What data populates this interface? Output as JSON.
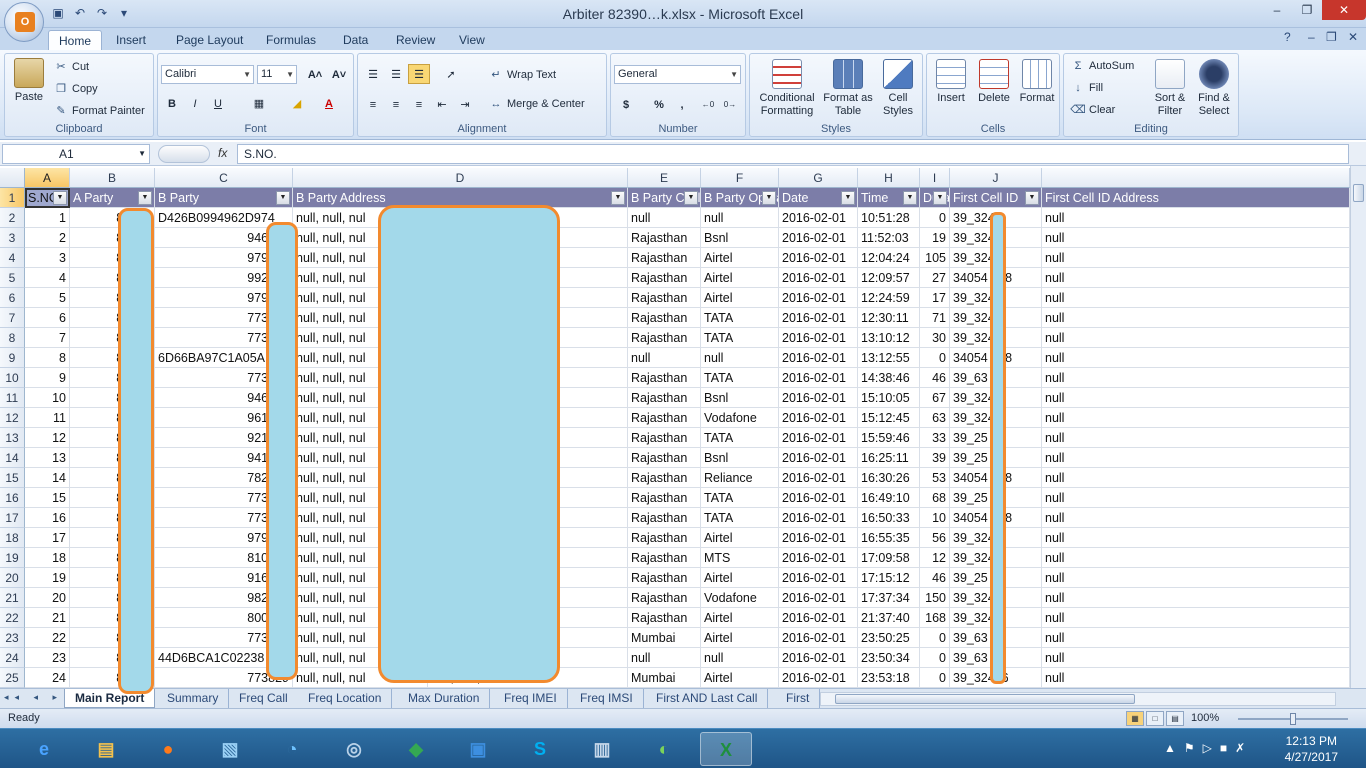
{
  "window": {
    "title": "Arbiter 82390…k.xlsx - Microsoft Excel",
    "min": "–",
    "restore": "❐",
    "close": "✕",
    "ribbon_min": "–",
    "ribbon_restore": "❐",
    "ribbon_close": "✕"
  },
  "office_button": "Ofc",
  "qat": {
    "save": "💾",
    "undo": "↶",
    "redo": "↷",
    "customize": "▾"
  },
  "tabs": [
    "Home",
    "Insert",
    "Page Layout",
    "Formulas",
    "Data",
    "Review",
    "View"
  ],
  "help": "?",
  "ribbon": {
    "clipboard": {
      "label": "Clipboard",
      "paste": "Paste",
      "cut": "Cut",
      "copy": "Copy",
      "format_painter": "Format Painter"
    },
    "font": {
      "label": "Font",
      "name": "Calibri",
      "size": "11",
      "bold": "B",
      "italic": "I",
      "underline": "U",
      "grow": "A˄",
      "shrink": "A˅"
    },
    "alignment": {
      "label": "Alignment",
      "wrap_text": "Wrap Text",
      "merge_center": "Merge & Center"
    },
    "number": {
      "label": "Number",
      "format": "General",
      "currency": "$",
      "percent": "%",
      "comma": ",",
      "inc_dec": ".0→.00",
      "dec_dec": ".00→.0"
    },
    "styles": {
      "label": "Styles",
      "conditional": "Conditional Formatting",
      "format_table": "Format as Table",
      "cell_styles": "Cell Styles"
    },
    "cells": {
      "label": "Cells",
      "insert": "Insert",
      "delete": "Delete",
      "format": "Format"
    },
    "editing": {
      "label": "Editing",
      "autosum": "AutoSum",
      "fill": "Fill",
      "clear": "Clear",
      "sort_filter": "Sort & Filter",
      "find_select": "Find & Select"
    }
  },
  "formula_bar": {
    "name_box": "A1",
    "fx": "fx",
    "content": "S.NO."
  },
  "columns": [
    "A",
    "B",
    "C",
    "D",
    "E",
    "F",
    "G",
    "H",
    "I",
    "J"
  ],
  "headers": [
    "S.NO.",
    "A Party",
    "B Party",
    "B Party Address",
    "B Party Circle",
    "B Party Operator",
    "Date",
    "Time",
    "Duration",
    "First Cell ID",
    "First Cell ID Address"
  ],
  "rows": [
    [
      "1",
      "82390",
      "D426B0994962D974",
      "null, null, nul",
      "null, null, null",
      "null",
      "null",
      "2016-02-01",
      "10:51:28",
      "0",
      "39_324",
      "null"
    ],
    [
      "2",
      "82390",
      "946107",
      "null, null, nul",
      "null, null, null",
      "Rajasthan",
      "Bsnl",
      "2016-02-01",
      "11:52:03",
      "19",
      "39_324",
      "null"
    ],
    [
      "3",
      "82390",
      "979973",
      "null, null, nul",
      "null, null, null",
      "Rajasthan",
      "Airtel",
      "2016-02-01",
      "12:04:24",
      "105",
      "39_324",
      "null"
    ],
    [
      "4",
      "82390",
      "992800",
      "null, null, nul",
      "null, null, null",
      "Rajasthan",
      "Airtel",
      "2016-02-01",
      "12:09:57",
      "27",
      "34054 738",
      "null"
    ],
    [
      "5",
      "82390",
      "979973",
      "null, null, nul",
      "null, null, null",
      "Rajasthan",
      "Airtel",
      "2016-02-01",
      "12:24:59",
      "17",
      "39_324",
      "null"
    ],
    [
      "6",
      "82390",
      "773792",
      "null, null, nul",
      "null, null, null",
      "Rajasthan",
      "TATA",
      "2016-02-01",
      "12:30:11",
      "71",
      "39_324",
      "null"
    ],
    [
      "7",
      "82390",
      "773792",
      "null, null, nul",
      "null, null, null",
      "Rajasthan",
      "TATA",
      "2016-02-01",
      "13:10:12",
      "30",
      "39_324",
      "null"
    ],
    [
      "8",
      "82390",
      "6D66BA97C1A05A",
      "null, null, nul",
      "null, null, null",
      "null",
      "null",
      "2016-02-01",
      "13:12:55",
      "0",
      "34054 738",
      "null"
    ],
    [
      "9",
      "82390",
      "773700",
      "null, null, nul",
      "null, null, null",
      "Rajasthan",
      "TATA",
      "2016-02-01",
      "14:38:46",
      "46",
      "39_63",
      "null"
    ],
    [
      "10",
      "82390",
      "946032",
      "null, null, nul",
      "null, null, null",
      "Rajasthan",
      "Bsnl",
      "2016-02-01",
      "15:10:05",
      "67",
      "39_324",
      "null"
    ],
    [
      "11",
      "82390",
      "961015",
      "null, null, nul",
      "null, null, null",
      "Rajasthan",
      "Vodafone",
      "2016-02-01",
      "15:12:45",
      "63",
      "39_324",
      "null"
    ],
    [
      "12",
      "82390",
      "921469",
      "null, null, nul",
      "null, null, null",
      "Rajasthan",
      "TATA",
      "2016-02-01",
      "15:59:46",
      "33",
      "39_25",
      "null"
    ],
    [
      "13",
      "82390",
      "941433",
      "null, null, nul",
      "null, null, null",
      "Rajasthan",
      "Bsnl",
      "2016-02-01",
      "16:25:11",
      "39",
      "39_25",
      "null"
    ],
    [
      "14",
      "82390",
      "782297",
      "null, null, nul",
      "null, null, null",
      "Rajasthan",
      "Reliance",
      "2016-02-01",
      "16:30:26",
      "53",
      "34054 738",
      "null"
    ],
    [
      "15",
      "82390",
      "773775",
      "null, null, nul",
      "null, null, null",
      "Rajasthan",
      "TATA",
      "2016-02-01",
      "16:49:10",
      "68",
      "39_25",
      "null"
    ],
    [
      "16",
      "82390",
      "773775",
      "null, null, nul",
      "null, null, null",
      "Rajasthan",
      "TATA",
      "2016-02-01",
      "16:50:33",
      "10",
      "34054 738",
      "null"
    ],
    [
      "17",
      "82390",
      "979973",
      "null, null, nul",
      "null, null, null",
      "Rajasthan",
      "Airtel",
      "2016-02-01",
      "16:55:35",
      "56",
      "39_324",
      "null"
    ],
    [
      "18",
      "82390",
      "810469",
      "null, null, nul",
      "null, null, null",
      "Rajasthan",
      "MTS",
      "2016-02-01",
      "17:09:58",
      "12",
      "39_324",
      "null"
    ],
    [
      "19",
      "82390",
      "916688",
      "null, null, nul",
      "null, null, null",
      "Rajasthan",
      "Airtel",
      "2016-02-01",
      "17:15:12",
      "46",
      "39_25",
      "null"
    ],
    [
      "20",
      "82390",
      "982818",
      "null, null, nul",
      "null, null, null",
      "Rajasthan",
      "Vodafone",
      "2016-02-01",
      "17:37:34",
      "150",
      "39_324",
      "null"
    ],
    [
      "21",
      "82390",
      "800341",
      "null, null, nul",
      "null, null, null",
      "Rajasthan",
      "Airtel",
      "2016-02-01",
      "21:37:40",
      "168",
      "39_324",
      "null"
    ],
    [
      "22",
      "82390",
      "773829",
      "null, null, nul",
      "null, null, null",
      "Mumbai",
      "Airtel",
      "2016-02-01",
      "23:50:25",
      "0",
      "39_63",
      "null"
    ],
    [
      "23",
      "82390",
      "44D6BCA1C02238",
      "null, null, nul",
      "null, null, null",
      "null",
      "null",
      "2016-02-01",
      "23:50:34",
      "0",
      "39_63",
      "null"
    ],
    [
      "24",
      "82390",
      "773829",
      "null, null, nul",
      "null, null, null",
      "Mumbai",
      "Airtel",
      "2016-02-01",
      "23:53:18",
      "0",
      "39_32476",
      "null"
    ]
  ],
  "sheets": [
    "Main Report",
    "Summary",
    "Freq Call",
    "Freq Location",
    "Max Duration",
    "Freq IMEI",
    "Freq IMSI",
    "First AND Last Call",
    "First"
  ],
  "sheet_nav": "◂◂ ◂ ▸ ▸▸",
  "status": {
    "ready": "Ready",
    "zoom": "100%"
  },
  "taskbar": {
    "icons": [
      "ie-icon",
      "folder-icon",
      "firefox-icon",
      "app-icon",
      "speed-icon",
      "search-icon",
      "maps-icon",
      "network-icon",
      "skype-icon",
      "monitor-icon",
      "android-icon",
      "excel-icon"
    ],
    "time": "12:13 PM",
    "date": "4/27/2017"
  }
}
